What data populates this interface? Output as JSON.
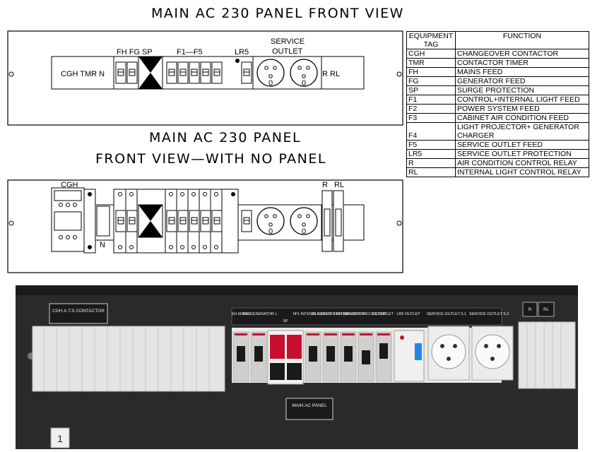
{
  "titles": {
    "front_view": "MAIN AC 230 PANEL FRONT VIEW",
    "no_panel_line1": "MAIN AC 230 PANEL",
    "no_panel_line2": "FRONT VIEW—WITH NO PANEL"
  },
  "front_panel": {
    "left_labels": "CGH  TMR  N",
    "group_fh_fg_sp": "FH FG SP",
    "group_f1_f5": "F1—F5",
    "group_lr5": "LR5",
    "service_outlet_line1": "SERVICE",
    "service_outlet_line2": "OUTLET",
    "socket_label_1": "0",
    "socket_label_2": "0",
    "right_labels": "R  RL"
  },
  "no_panel": {
    "cgh_label": "CGH",
    "n_label": "N",
    "r_label": "R",
    "rl_label": "RL",
    "socket_label_1": "0",
    "socket_label_2": "0"
  },
  "table": {
    "header_tag": "EQUIPMENT TAG",
    "header_function": "FUNCTION",
    "rows": [
      {
        "tag": "CGH",
        "function": "CHANGEOVER CONTACTOR"
      },
      {
        "tag": "TMR",
        "function": "CONTACTOR TIMER"
      },
      {
        "tag": "FH",
        "function": "MAINS FEED"
      },
      {
        "tag": "FG",
        "function": "GENERATOR FEED"
      },
      {
        "tag": "SP",
        "function": "SURGE PROTECTION"
      },
      {
        "tag": "F1",
        "function": "CONTROL+INTERNAL LIGHT FEED"
      },
      {
        "tag": "F2",
        "function": "POWER SYSTEM FEED"
      },
      {
        "tag": "F3",
        "function": "CABINET AIR CONDITION FEED"
      },
      {
        "tag": "F4",
        "function": "LIGHT PROJECTOR+ GENERATOR CHARGER"
      },
      {
        "tag": "F5",
        "function": "SERVICE OUTLET FEED"
      },
      {
        "tag": "LR5",
        "function": "SERVICE OUTLET PROTECTION"
      },
      {
        "tag": "R",
        "function": "AIR CONDITION CONTROL RELAY"
      },
      {
        "tag": "RL",
        "function": "INTERNAL LIGHT CONTROL RELAY"
      }
    ]
  },
  "photo": {
    "cgh_plate": "CGH A.T.S CONTACTOR",
    "labels": {
      "fh": "EH MAINS",
      "fg": "EG GENERATOR",
      "l": "L",
      "n": "N",
      "sp": "SP",
      "f1": "F1 INTENAL LIGHT",
      "f2": "F2 POWER SYSTEM",
      "f3": "F3 AIR CONDITION",
      "f4": "F4 LIGHT PROJECTOR",
      "f5": "F5 OUTLET",
      "lr5": "LR5 OUTLET",
      "so1": "SERVICE OUTLET 5.1",
      "so2": "SERVICE OUTLET 5.2",
      "r": "R",
      "rl": "RL"
    },
    "main_plate": "MAIN AC PANEL",
    "panel_number": "1"
  }
}
